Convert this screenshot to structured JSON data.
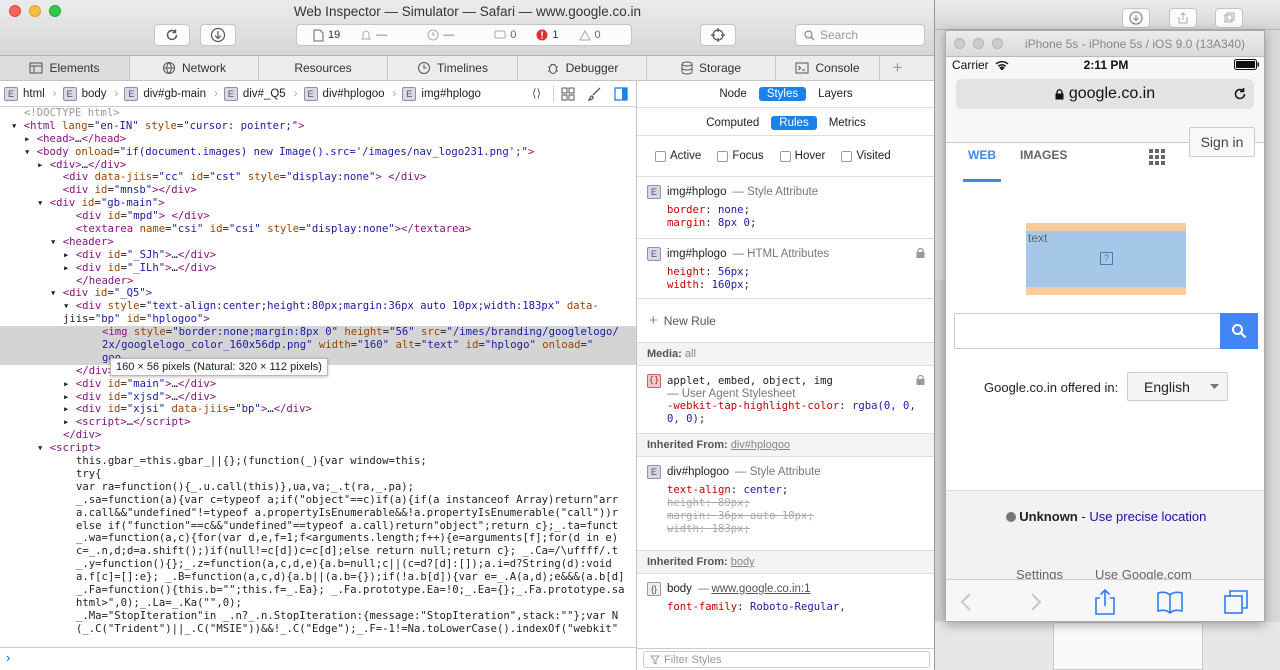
{
  "window": {
    "title": "Web Inspector — Simulator — Safari — www.google.co.in"
  },
  "toolbar": {
    "resources": "19",
    "warnings": "—",
    "timers": "—",
    "messages": "0",
    "errors": "1",
    "alerts": "0",
    "search_placeholder": "Search"
  },
  "tabs": [
    "Elements",
    "Network",
    "Resources",
    "Timelines",
    "Debugger",
    "Storage",
    "Console"
  ],
  "breadcrumb": [
    "html",
    "body",
    "div#gb-main",
    "div#_Q5",
    "div#hplogoo",
    "img#hplogo"
  ],
  "dom_lines": [
    {
      "i": 0,
      "h": "<span class='cm'>&lt;!DOCTYPE html&gt;</span>"
    },
    {
      "i": 0,
      "h": "▾ <span class='tg'>&lt;html</span> <span class='at'>lang</span>=<span class='av'>\"en-IN\"</span> <span class='at'>style</span>=<span class='av'>\"cursor: pointer;\"</span><span class='tg'>&gt;</span>"
    },
    {
      "i": 1,
      "h": "▸ <span class='tg'>&lt;head&gt;</span>…<span class='tg'>&lt;/head&gt;</span>"
    },
    {
      "i": 1,
      "h": "▾ <span class='tg'>&lt;body</span> <span class='at'>onload</span>=<span class='av'>\"if(document.images) new Image().src='/images/nav_logo231.png';\"</span><span class='tg'>&gt;</span>"
    },
    {
      "i": 2,
      "h": "▸ <span class='tg'>&lt;div&gt;</span>…<span class='tg'>&lt;/div&gt;</span>"
    },
    {
      "i": 2,
      "h": "  <span class='tg'>&lt;div</span> <span class='at'>data-jiis</span>=<span class='av'>\"cc\"</span> <span class='at'>id</span>=<span class='av'>\"cst\"</span> <span class='at'>style</span>=<span class='av'>\"display:none\"</span><span class='tg'>&gt;</span> <span class='tg'>&lt;/div&gt;</span>"
    },
    {
      "i": 2,
      "h": "  <span class='tg'>&lt;div</span> <span class='at'>id</span>=<span class='av'>\"mnsb\"</span><span class='tg'>&gt;&lt;/div&gt;</span>"
    },
    {
      "i": 2,
      "h": "▾ <span class='tg'>&lt;div</span> <span class='at'>id</span>=<span class='av'>\"gb-main\"</span><span class='tg'>&gt;</span>"
    },
    {
      "i": 3,
      "h": "  <span class='tg'>&lt;div</span> <span class='at'>id</span>=<span class='av'>\"mpd\"</span><span class='tg'>&gt;</span> <span class='tg'>&lt;/div&gt;</span>"
    },
    {
      "i": 3,
      "h": "  <span class='tg'>&lt;textarea</span> <span class='at'>name</span>=<span class='av'>\"csi\"</span> <span class='at'>id</span>=<span class='av'>\"csi\"</span> <span class='at'>style</span>=<span class='av'>\"display:none\"</span><span class='tg'>&gt;&lt;/textarea&gt;</span>"
    },
    {
      "i": 3,
      "h": "▾ <span class='tg'>&lt;header&gt;</span>"
    },
    {
      "i": 4,
      "h": "▸ <span class='tg'>&lt;div</span> <span class='at'>id</span>=<span class='av'>\"_SJh\"</span><span class='tg'>&gt;</span>…<span class='tg'>&lt;/div&gt;</span>"
    },
    {
      "i": 4,
      "h": "▸ <span class='tg'>&lt;div</span> <span class='at'>id</span>=<span class='av'>\"_ILh\"</span><span class='tg'>&gt;</span>…<span class='tg'>&lt;/div&gt;</span>"
    },
    {
      "i": 4,
      "h": "<span class='tg'>&lt;/header&gt;</span>"
    },
    {
      "i": 3,
      "h": "▾ <span class='tg'>&lt;div</span> <span class='at'>id</span>=<span class='av'>\"_Q5\"</span><span class='tg'>&gt;</span>"
    },
    {
      "i": 4,
      "h": "▾ <span class='tg'>&lt;div</span> <span class='at'>style</span>=<span class='av'>\"text-align:center;height:80px;margin:36px auto 10px;width:183px\"</span> <span class='at'>data-</span>"
    },
    {
      "i": 3,
      "h": "jiis=<span class='av'>\"bp\"</span> <span class='at'>id</span>=<span class='av'>\"hplogoo\"</span><span class='tg'>&gt;</span>"
    },
    {
      "i": 6,
      "s": 1,
      "h": "<span class='tg'>&lt;img</span> <span class='at'>style</span>=<span class='av'>\"border:none;margin:8px 0\"</span> <span class='at'>height</span>=<span class='av'>\"56\"</span> <span class='at'>src</span>=<span class='av'>\"/imes/branding/googlelogo/</span>"
    },
    {
      "i": 6,
      "s": 1,
      "h": "<span class='av'>2x/googlelogo_color_160x56dp.png\"</span> <span class='at'>width</span>=<span class='av'>\"160\"</span> <span class='at'>alt</span>=<span class='av'>\"text\"</span> <span class='at'>id</span>=<span class='av'>\"hplogo\"</span> <span class='at'>onload</span>=<span class='av'>\"</span>"
    },
    {
      "i": 6,
      "s": 1,
      "h": "<span class='av'>goo</span>"
    },
    {
      "i": 4,
      "h": "<span class='tg'>&lt;/div&gt;</span>"
    },
    {
      "i": 4,
      "h": "▸ <span class='tg'>&lt;div</span> <span class='at'>id</span>=<span class='av'>\"main\"</span><span class='tg'>&gt;</span>…<span class='tg'>&lt;/div&gt;</span>"
    },
    {
      "i": 4,
      "h": "▸ <span class='tg'>&lt;div</span> <span class='at'>id</span>=<span class='av'>\"xjsd\"</span><span class='tg'>&gt;</span>…<span class='tg'>&lt;/div&gt;</span>"
    },
    {
      "i": 4,
      "h": "▸ <span class='tg'>&lt;div</span> <span class='at'>id</span>=<span class='av'>\"xjsi\"</span> <span class='at'>data-jiis</span>=<span class='av'>\"bp\"</span><span class='tg'>&gt;</span>…<span class='tg'>&lt;/div&gt;</span>"
    },
    {
      "i": 4,
      "h": "▸ <span class='tg'>&lt;script&gt;</span>…<span class='tg'>&lt;/script&gt;</span>"
    },
    {
      "i": 3,
      "h": "<span class='tg'>&lt;/div&gt;</span>"
    },
    {
      "i": 2,
      "h": "▾ <span class='tg'>&lt;script&gt;</span>"
    },
    {
      "i": 4,
      "h": "this.gbar_=this.gbar_||{};(function(_){var window=this;"
    },
    {
      "i": 4,
      "h": "try{"
    },
    {
      "i": 4,
      "h": "var ra=function(){_.u.call(this)},ua,va;_.t(ra,_.pa);"
    },
    {
      "i": 4,
      "h": "_.sa=function(a){var c=typeof a;if(\"object\"==c)if(a){if(a instanceof Array)return\"arr"
    },
    {
      "i": 4,
      "h": "a.call&&\"undefined\"!=typeof a.propertyIsEnumerable&&!a.propertyIsEnumerable(\"call\"))r"
    },
    {
      "i": 4,
      "h": "else if(\"function\"==c&&\"undefined\"==typeof a.call)return\"object\";return c};_.ta=funct"
    },
    {
      "i": 4,
      "h": "_.wa=function(a,c){for(var d,e,f=1;f&lt;arguments.length;f++){e=arguments[f];for(d in e)"
    },
    {
      "i": 4,
      "h": "c=_.n,d;d=a.shift();)if(null!=c[d])c=c[d];else return null;return c}; _.Ca=/\\uffff/.t"
    },
    {
      "i": 4,
      "h": "_.y=function(){};_.z=function(a,c,d,e){a.b=null;c||(c=d?[d]:[]);a.i=d?String(d):void"
    },
    {
      "i": 4,
      "h": "a.f[c]=[]:e}; _.B=function(a,c,d){a.b||(a.b={});if(!a.b[d]){var e=_.A(a,d);e&&&(a.b[d]"
    },
    {
      "i": 4,
      "h": "_.Fa=function(){this.b=\"\";this.f=_.Ea}; _.Fa.prototype.Ea=!0;_.Ea={};_.Fa.prototype.sa"
    },
    {
      "i": 4,
      "h": "html&gt;\",0);_.La=_.Ka(\"\",0);"
    },
    {
      "i": 4,
      "h": "_.Ma=\"StopIteration\"in _.n?_.n.StopIteration:{message:\"StopIteration\",stack:\"\"};var N"
    },
    {
      "i": 4,
      "h": "(_.C(\"Trident\")||_.C(\"MSIE\"))&&!_.C(\"Edge\");_.F=-1!=Na.toLowerCase().indexOf(\"webkit\""
    }
  ],
  "tooltip": "160 × 56 pixels (Natural: 320 × 112 pixels)",
  "console": {
    "prompt": "›"
  },
  "sidebar": {
    "top_tabs": [
      "Node",
      "Styles",
      "Layers"
    ],
    "top_active": 1,
    "sub_tabs": [
      "Computed",
      "Rules",
      "Metrics"
    ],
    "sub_active": 1,
    "pseudo": [
      "Active",
      "Focus",
      "Hover",
      "Visited"
    ],
    "rule1": {
      "selector": "img#hplogo",
      "origin": "— Style Attribute",
      "decls": [
        [
          "border",
          "none"
        ],
        [
          "margin",
          "8px 0"
        ]
      ]
    },
    "rule2": {
      "selector": "img#hplogo",
      "origin": "— HTML Attributes",
      "decls": [
        [
          "height",
          "56px"
        ],
        [
          "width",
          "160px"
        ]
      ]
    },
    "new_rule": "New Rule",
    "media_label": "Media:",
    "media_value": "all",
    "rule3": {
      "selector": "applet, embed, object, img",
      "origin": "— User Agent Stylesheet",
      "decls": [
        [
          "-webkit-tap-highlight-color",
          "rgba(0, 0, 0, 0)"
        ]
      ]
    },
    "inh1_label": "Inherited From:",
    "inh1_value": "div#hplogoo",
    "rule4": {
      "selector": "div#hplogoo",
      "origin": "— Style Attribute",
      "decls": [
        [
          "text-align",
          "center"
        ]
      ],
      "struck": [
        [
          "height",
          "80px"
        ],
        [
          "margin",
          "36px auto 10px"
        ],
        [
          "width",
          "183px"
        ]
      ]
    },
    "inh2_label": "Inherited From:",
    "inh2_value": "body",
    "rule5": {
      "selector": "body",
      "origin": "— ",
      "link": "www.google.co.in:1",
      "decls": [
        [
          "font-family",
          "Roboto-Regular,"
        ]
      ]
    },
    "filter_placeholder": "Filter Styles"
  },
  "simulator": {
    "title": "iPhone 5s - iPhone 5s / iOS 9.0 (13A340)",
    "carrier": "Carrier",
    "time": "2:11 PM",
    "url": "google.co.in",
    "nav": [
      "WEB",
      "IMAGES"
    ],
    "sign_in": "Sign in",
    "logo_alt": "text",
    "offered": "Google.co.in offered in:",
    "language": "English",
    "location_bold": "Unknown",
    "location_link": "Use precise location",
    "footer": [
      "Settings",
      "Use Google.com"
    ]
  },
  "colors": {
    "accent": "#1a82ea",
    "google_blue": "#4285f4"
  }
}
